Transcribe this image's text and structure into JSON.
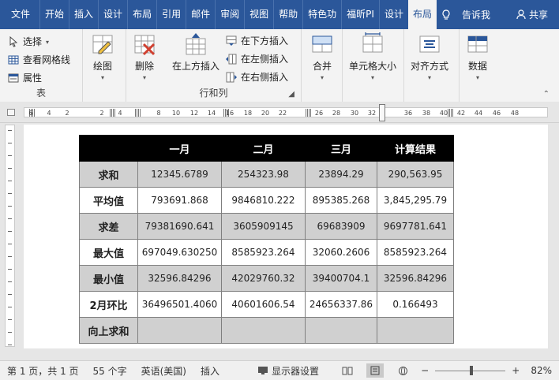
{
  "tabs": [
    "文件",
    "开始",
    "插入",
    "设计",
    "布局",
    "引用",
    "邮件",
    "审阅",
    "视图",
    "帮助",
    "特色功",
    "福昕PI",
    "设计",
    "布局"
  ],
  "active_tab_index": 13,
  "tellme": "告诉我",
  "share": "共享",
  "ribbon": {
    "table_group": {
      "label": "表",
      "select": "选择",
      "grid": "查看网格线",
      "props": "属性"
    },
    "draw": "绘图",
    "rows_group": {
      "label": "行和列",
      "delete": "删除",
      "insert_above": "在上方插入",
      "insert_below": "在下方插入",
      "insert_left": "在左侧插入",
      "insert_right": "在右侧插入"
    },
    "merge": "合并",
    "cell_size": "单元格大小",
    "alignment": "对齐方式",
    "data": "数据"
  },
  "ruler_numbers": [
    "6",
    "4",
    "2",
    "2",
    "4",
    "8",
    "10",
    "12",
    "14",
    "16",
    "18",
    "20",
    "22",
    "26",
    "28",
    "30",
    "32",
    "36",
    "38",
    "40",
    "42",
    "44",
    "46",
    "48"
  ],
  "table": {
    "headers": [
      "",
      "一月",
      "二月",
      "三月",
      "计算结果"
    ],
    "rows": [
      {
        "label": "求和",
        "cells": [
          "12345.6789",
          "254323.98",
          "23894.29",
          "290,563.95"
        ]
      },
      {
        "label": "平均值",
        "cells": [
          "793691.868",
          "9846810.222",
          "895385.268",
          "3,845,295.79"
        ]
      },
      {
        "label": "求差",
        "cells": [
          "79381690.641",
          "3605909145",
          "69683909",
          "9697781.641"
        ]
      },
      {
        "label": "最大值",
        "cells": [
          "697049.630250",
          "8585923.264",
          "32060.2606",
          "8585923.264"
        ]
      },
      {
        "label": "最小值",
        "cells": [
          "32596.84296",
          "42029760.32",
          "39400704.1",
          "32596.84296"
        ]
      },
      {
        "label": "2月环比",
        "cells": [
          "36496501.4060",
          "40601606.54",
          "24656337.86",
          "0.166493"
        ]
      },
      {
        "label": "向上求和",
        "cells": [
          "",
          "",
          "",
          ""
        ]
      }
    ]
  },
  "status": {
    "page": "第 1 页，共 1 页",
    "words": "55 个字",
    "lang": "英语(美国)",
    "mode": "插入",
    "display": "显示器设置",
    "zoom": "82%",
    "minus": "−",
    "plus": "+"
  },
  "colors": {
    "accent": "#2b579a",
    "header_bg": "#000000",
    "gray_row": "#d0d0d0"
  }
}
